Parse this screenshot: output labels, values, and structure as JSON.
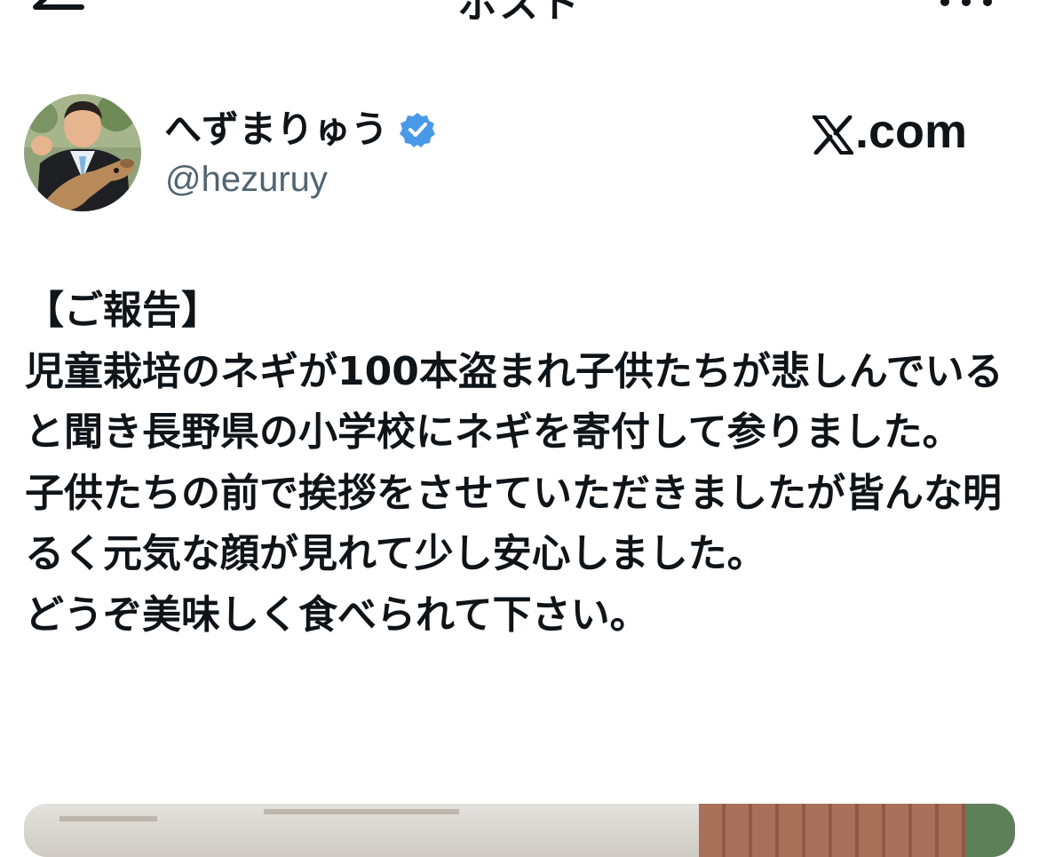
{
  "navbar": {
    "title": "ポスト",
    "back_icon": "arrow-left-icon",
    "more_icon": "more-dots-icon"
  },
  "author": {
    "display_name": "へずまりゅう",
    "handle": "@hezuruy",
    "verified": true,
    "verified_color": "#4a99e9"
  },
  "source": {
    "label": ".com"
  },
  "post": {
    "text": "【ご報告】\n児童栽培のネギが100本盗まれ子供たちが悲しんでいると聞き長野県の小学校にネギを寄付して参りました。\n子供たちの前で挨拶をさせていただきましたが皆んな明るく元気な顔が見れて少し安心しました。\nどうぞ美味しく食べられて下さい。"
  },
  "colors": {
    "text": "#0f1419",
    "secondary": "#536471",
    "background": "#ffffff"
  }
}
